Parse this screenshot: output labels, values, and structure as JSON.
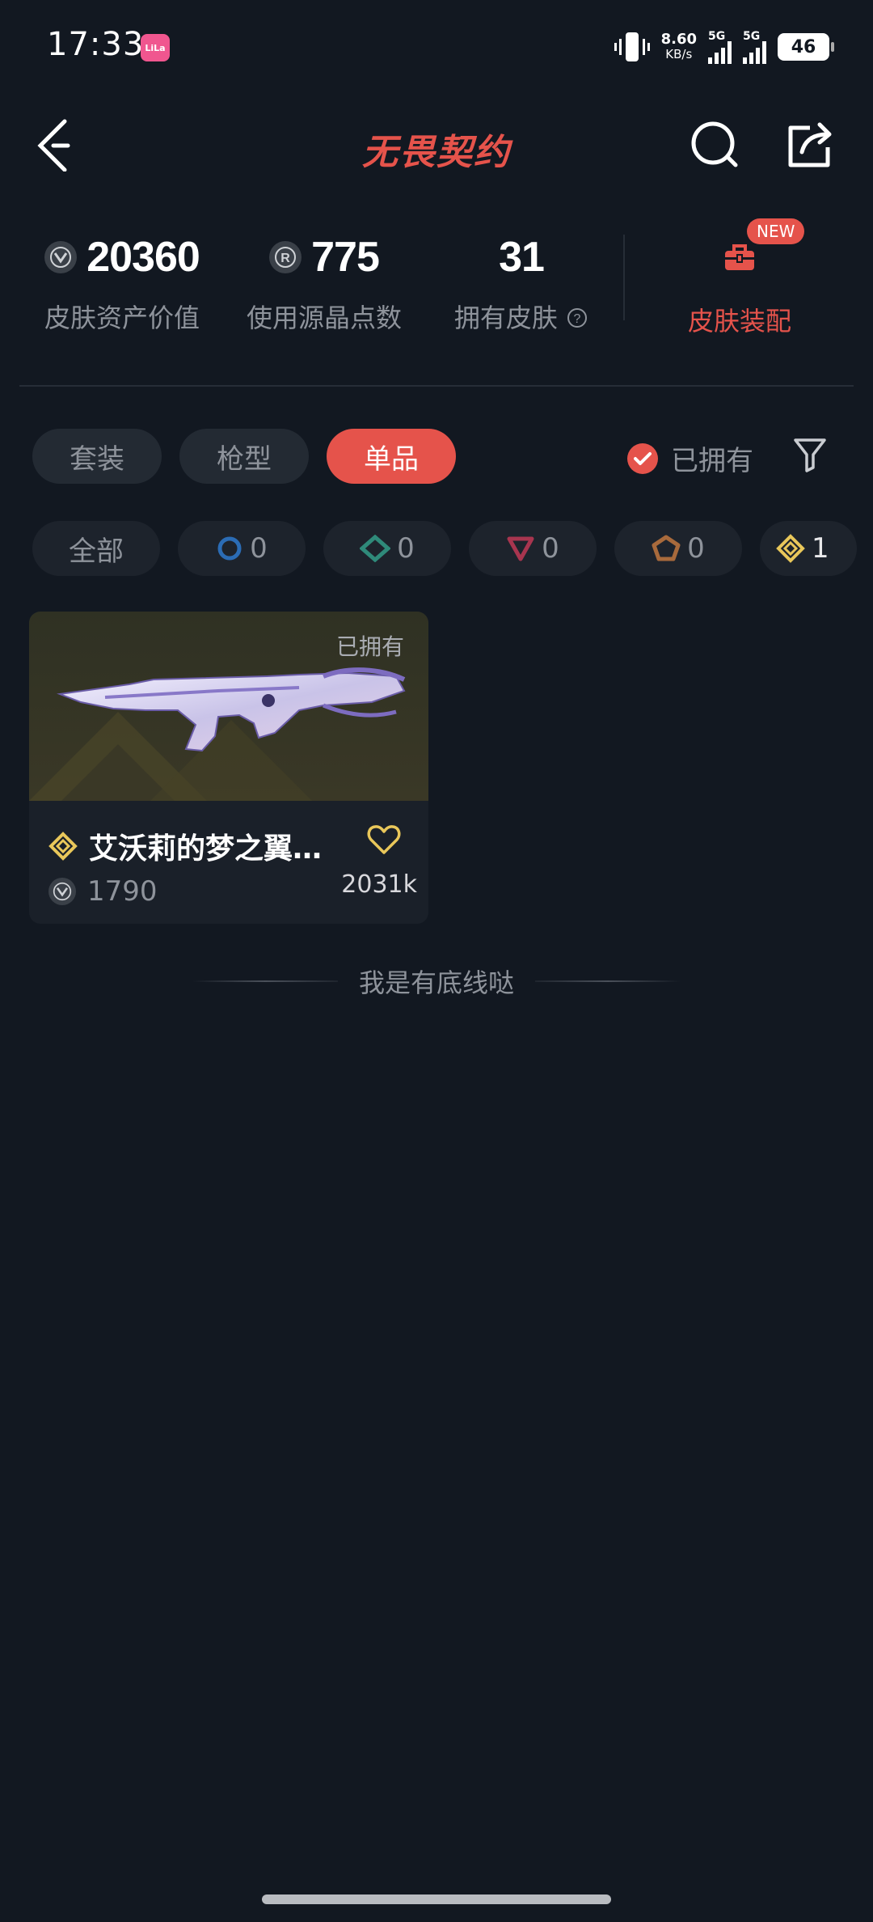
{
  "status_bar": {
    "time": "17:33",
    "app_badge": "LiLa",
    "net_speed": "8.60",
    "net_unit": "KB/s",
    "sim1": "5G",
    "sim2": "5G",
    "battery": "46"
  },
  "header": {
    "title": "无畏契约",
    "icons": [
      "back-icon",
      "search-icon",
      "share-icon"
    ]
  },
  "stats": {
    "asset_value": "20360",
    "asset_label": "皮肤资产价值",
    "points_value": "775",
    "points_label": "使用源晶点数",
    "owned_count": "31",
    "owned_label": "拥有皮肤",
    "equip_label": "皮肤装配",
    "new_badge": "NEW"
  },
  "tabs": [
    {
      "label": "套装",
      "active": false
    },
    {
      "label": "枪型",
      "active": false
    },
    {
      "label": "单品",
      "active": true
    }
  ],
  "owned_filter": {
    "label": "已拥有",
    "checked": true
  },
  "rarity_chips": [
    {
      "label": "全部"
    },
    {
      "count": "0",
      "color": "#2b6cb5"
    },
    {
      "count": "0",
      "color": "#2f8a7a"
    },
    {
      "count": "0",
      "color": "#a8354f"
    },
    {
      "count": "0",
      "color": "#a86a3c"
    },
    {
      "count": "1",
      "color": "#e9c75a"
    }
  ],
  "items": [
    {
      "tag": "已拥有",
      "name": "艾沃莉的梦之翼…",
      "price": "1790",
      "likes": "2031k",
      "rarity_color": "#e9c75a"
    }
  ],
  "footer_text": "我是有底线哒"
}
